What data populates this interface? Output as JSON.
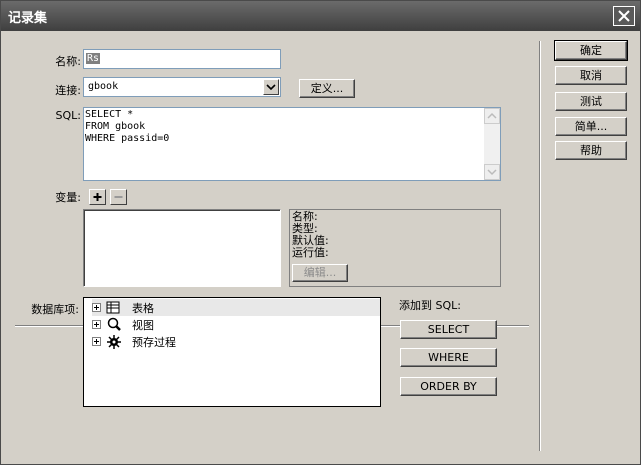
{
  "window": {
    "title": "记录集"
  },
  "form": {
    "name_label": "名称:",
    "name_value": "Rs",
    "connection_label": "连接:",
    "connection_value": "gbook",
    "define_button": "定义...",
    "sql_label": "SQL:",
    "sql_lines": [
      "SELECT *",
      "FROM gbook",
      "WHERE passid=0"
    ],
    "variables_label": "变量:",
    "variable_props": {
      "name": "名称:",
      "type": "类型:",
      "default": "默认值:",
      "runtime": "运行值:"
    },
    "edit_button": "编辑...",
    "db_items_label": "数据库项:",
    "db_items": [
      {
        "label": "表格",
        "icon": "table-icon"
      },
      {
        "label": "视图",
        "icon": "view-icon"
      },
      {
        "label": "预存过程",
        "icon": "stored-procedure-icon"
      }
    ],
    "add_to_sql_label": "添加到 SQL:",
    "add_buttons": {
      "select": "SELECT",
      "where": "WHERE",
      "order_by": "ORDER BY"
    }
  },
  "side_buttons": {
    "ok": "确定",
    "cancel": "取消",
    "test": "测试",
    "simple": "简单...",
    "help": "帮助"
  }
}
